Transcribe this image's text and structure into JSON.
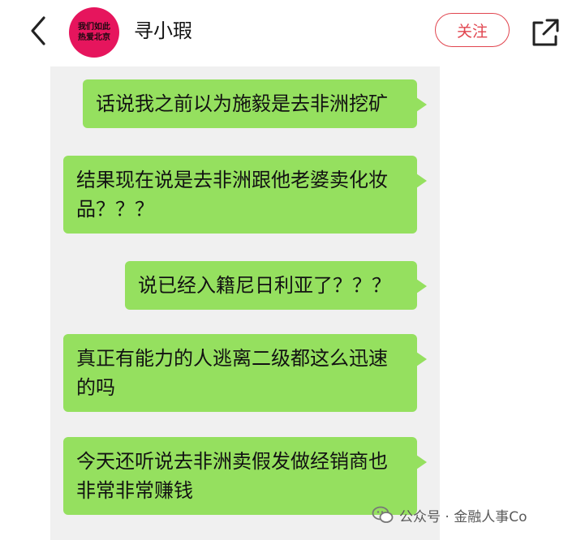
{
  "header": {
    "username": "寻小瑕",
    "avatar_text": "我们如此\n热爱北京",
    "follow_label": "关注",
    "back_icon": "chevron-left-icon",
    "share_icon": "share-external-icon"
  },
  "messages": [
    {
      "text": "话说我之前以为施毅是去非洲挖矿"
    },
    {
      "text": "结果现在说是去非洲跟他老婆卖化妆品？？？"
    },
    {
      "text": "说已经入籍尼日利亚了？？？"
    },
    {
      "text": "真正有能力的人逃离二级都这么迅速的吗"
    },
    {
      "text": "今天还听说去非洲卖假发做经销商也非常非常赚钱"
    }
  ],
  "watermark": {
    "text": "公众号 · 金融人事Co",
    "icon": "wechat-icon"
  },
  "colors": {
    "bubble": "#95e05f",
    "accent": "#e1454f",
    "avatar": "#e6155d"
  }
}
